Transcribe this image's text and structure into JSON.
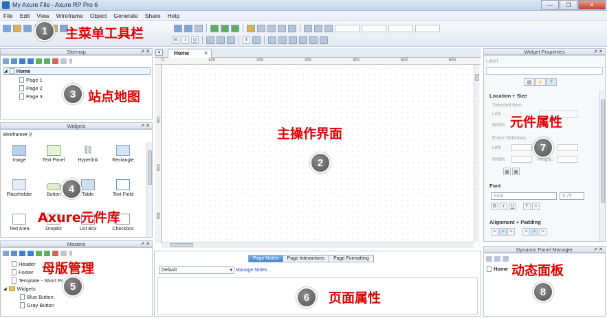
{
  "window": {
    "title": "My Axure File - Axure RP Pro 6",
    "buttons": [
      "—",
      "❐",
      "✕"
    ]
  },
  "menu": [
    "File",
    "Edit",
    "View",
    "Wireframe",
    "Object",
    "Generate",
    "Share",
    "Help"
  ],
  "toolbar": {
    "bold": "B",
    "italic": "I",
    "underline": "U",
    "text_color": "T"
  },
  "sitemap": {
    "title": "Sitemap",
    "root": "Home",
    "pages": [
      "Page 1",
      "Page 2",
      "Page 3"
    ]
  },
  "widgets": {
    "title": "Widgets",
    "library": "Wireframe",
    "items": [
      [
        "Image",
        "Text Panel",
        "Hyperlink",
        "Rectangle"
      ],
      [
        "Placeholder",
        "Button",
        "Table",
        "Text Field"
      ],
      [
        "Text Area",
        "Droplist",
        "List Box",
        "Checkbox"
      ]
    ]
  },
  "masters": {
    "title": "Masters",
    "items": [
      "Header",
      "Footer",
      "Template - Short Pr"
    ],
    "folder": "Widgets",
    "folder_items": [
      "Blue Button",
      "Gray Button"
    ]
  },
  "canvas": {
    "tab": "Home",
    "ruler_h": [
      "0",
      "100",
      "200",
      "300",
      "400",
      "500",
      "600"
    ],
    "ruler_v": [
      "100",
      "200",
      "300"
    ]
  },
  "page_props": {
    "tabs": [
      "Page Notes",
      "Page Interactions",
      "Page Formatting"
    ],
    "select_value": "Default",
    "manage_link": "Manage Notes..."
  },
  "widget_props": {
    "title": "Widget Properties",
    "label": "Label",
    "location_size": "Location + Size",
    "selected_item": "Selected Item",
    "left": "Left:",
    "width": "Width:",
    "entire_selection": "Entire Selection",
    "height": "Height:",
    "font": "Font",
    "font_family": "Arial",
    "font_size": "9.75",
    "alignment": "Alignment + Padding"
  },
  "dynamic_panel": {
    "title": "Dynamic Panel Manager",
    "root": "Home"
  },
  "annotations": [
    {
      "num": "1",
      "text": "主菜单工具栏"
    },
    {
      "num": "2",
      "text": "主操作界面"
    },
    {
      "num": "3",
      "text": "站点地图"
    },
    {
      "num": "4",
      "text": "Axure元件库"
    },
    {
      "num": "5",
      "text": "母版管理"
    },
    {
      "num": "6",
      "text": "页面属性"
    },
    {
      "num": "7",
      "text": "元件属性"
    },
    {
      "num": "8",
      "text": "动态面板"
    }
  ],
  "colors": {
    "annotation": "#e10000",
    "accent": "#3d7fd0"
  }
}
